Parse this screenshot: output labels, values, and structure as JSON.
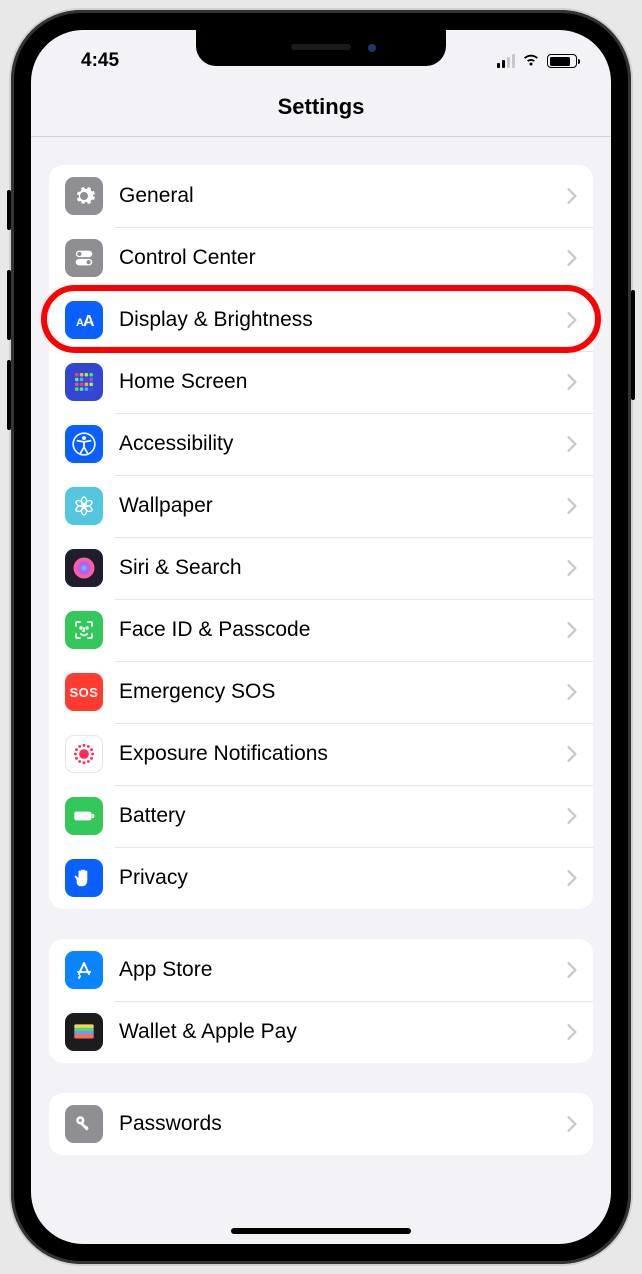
{
  "status": {
    "time": "4:45"
  },
  "header": {
    "title": "Settings"
  },
  "highlight_index": 2,
  "groups": [
    {
      "rows": [
        {
          "name": "general",
          "label": "General",
          "icon": "gear-icon",
          "color": "#8e8e93"
        },
        {
          "name": "control-center",
          "label": "Control Center",
          "icon": "toggles-icon",
          "color": "#8e8e93"
        },
        {
          "name": "display-brightness",
          "label": "Display & Brightness",
          "icon": "text-size-icon",
          "color": "#0a60ff"
        },
        {
          "name": "home-screen",
          "label": "Home Screen",
          "icon": "grid-icon",
          "color": "#3346d3"
        },
        {
          "name": "accessibility",
          "label": "Accessibility",
          "icon": "accessibility-icon",
          "color": "#0a60ff"
        },
        {
          "name": "wallpaper",
          "label": "Wallpaper",
          "icon": "flower-icon",
          "color": "#54c6e0"
        },
        {
          "name": "siri-search",
          "label": "Siri & Search",
          "icon": "siri-icon",
          "color": "#1e1e2e"
        },
        {
          "name": "face-id-passcode",
          "label": "Face ID & Passcode",
          "icon": "face-id-icon",
          "color": "#34c759"
        },
        {
          "name": "emergency-sos",
          "label": "Emergency SOS",
          "icon": "sos-icon",
          "color": "#ff3b30"
        },
        {
          "name": "exposure-notifications",
          "label": "Exposure Notifications",
          "icon": "exposure-icon",
          "color": "#ffffff"
        },
        {
          "name": "battery",
          "label": "Battery",
          "icon": "battery-icon",
          "color": "#34c759"
        },
        {
          "name": "privacy",
          "label": "Privacy",
          "icon": "hand-icon",
          "color": "#0a60ff"
        }
      ]
    },
    {
      "rows": [
        {
          "name": "app-store",
          "label": "App Store",
          "icon": "appstore-icon",
          "color": "#0a84ff"
        },
        {
          "name": "wallet-apple-pay",
          "label": "Wallet & Apple Pay",
          "icon": "wallet-icon",
          "color": "#1c1c1e"
        }
      ]
    },
    {
      "rows": [
        {
          "name": "passwords",
          "label": "Passwords",
          "icon": "key-icon",
          "color": "#8e8e93"
        }
      ]
    }
  ]
}
